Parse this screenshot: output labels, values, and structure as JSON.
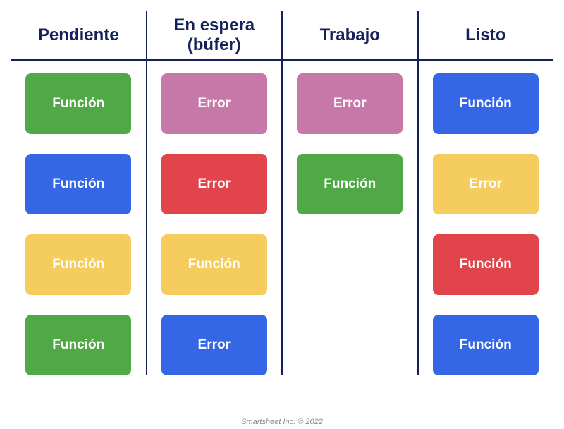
{
  "columns": [
    {
      "title": "Pendiente",
      "cards": [
        {
          "label": "Función",
          "color": "c-green"
        },
        {
          "label": "Función",
          "color": "c-blue"
        },
        {
          "label": "Función",
          "color": "c-yellow"
        },
        {
          "label": "Función",
          "color": "c-green"
        }
      ]
    },
    {
      "title": "En espera\n(búfer)",
      "cards": [
        {
          "label": "Error",
          "color": "c-mauve"
        },
        {
          "label": "Error",
          "color": "c-red"
        },
        {
          "label": "Función",
          "color": "c-yellow"
        },
        {
          "label": "Error",
          "color": "c-blue"
        }
      ]
    },
    {
      "title": "Trabajo",
      "cards": [
        {
          "label": "Error",
          "color": "c-mauve"
        },
        {
          "label": "Función",
          "color": "c-green"
        }
      ]
    },
    {
      "title": "Listo",
      "cards": [
        {
          "label": "Función",
          "color": "c-blue"
        },
        {
          "label": "Error",
          "color": "c-yellow"
        },
        {
          "label": "Función",
          "color": "c-red"
        },
        {
          "label": "Función",
          "color": "c-blue"
        }
      ]
    }
  ],
  "footer": "Smartsheet Inc. © 2022"
}
